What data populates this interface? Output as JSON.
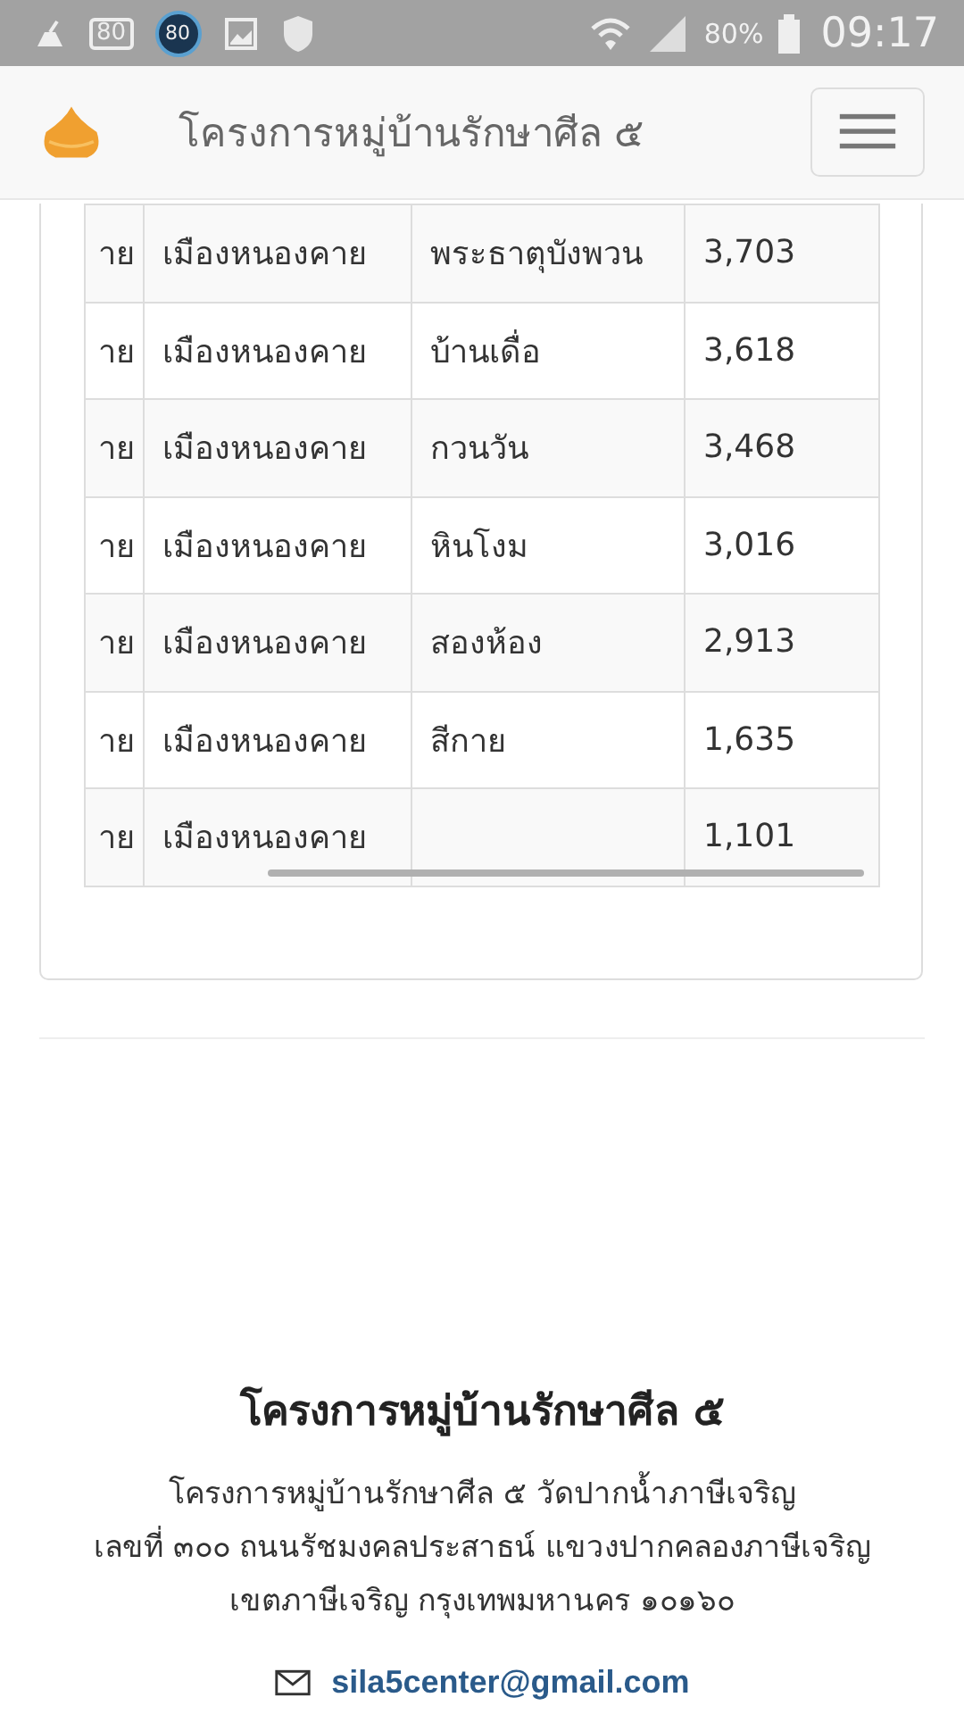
{
  "status_bar": {
    "icon_badges": [
      "80",
      "80"
    ],
    "battery": "80%",
    "time": "09:17"
  },
  "navbar": {
    "title": "โครงการหมู่บ้านรักษาศีล ๕"
  },
  "table": {
    "rows": [
      {
        "cells": [
          "าย",
          "เมืองหนองคาย",
          "พระธาตุบังพวน",
          "3,703"
        ]
      },
      {
        "cells": [
          "าย",
          "เมืองหนองคาย",
          "บ้านเดื่อ",
          "3,618"
        ]
      },
      {
        "cells": [
          "าย",
          "เมืองหนองคาย",
          "กวนวัน",
          "3,468"
        ]
      },
      {
        "cells": [
          "าย",
          "เมืองหนองคาย",
          "หินโงม",
          "3,016"
        ]
      },
      {
        "cells": [
          "าย",
          "เมืองหนองคาย",
          "สองห้อง",
          "2,913"
        ]
      },
      {
        "cells": [
          "าย",
          "เมืองหนองคาย",
          "สีกาย",
          "1,635"
        ]
      },
      {
        "cells": [
          "าย",
          "เมืองหนองคาย",
          "",
          "1,101"
        ]
      }
    ]
  },
  "footer": {
    "title": "โครงการหมู่บ้านรักษาศีล ๕",
    "address_lines": [
      "โครงการหมู่บ้านรักษาศีล ๕ วัดปากน้ำภาษีเจริญ",
      "เลขที่ ๓๐๐ ถนนรัชมงคลประสาธน์ แขวงปากคลองภาษีเจริญ",
      "เขตภาษีเจริญ กรุงเทพมหานคร ๑๐๑๖๐"
    ],
    "email": "sila5center@gmail.com"
  }
}
